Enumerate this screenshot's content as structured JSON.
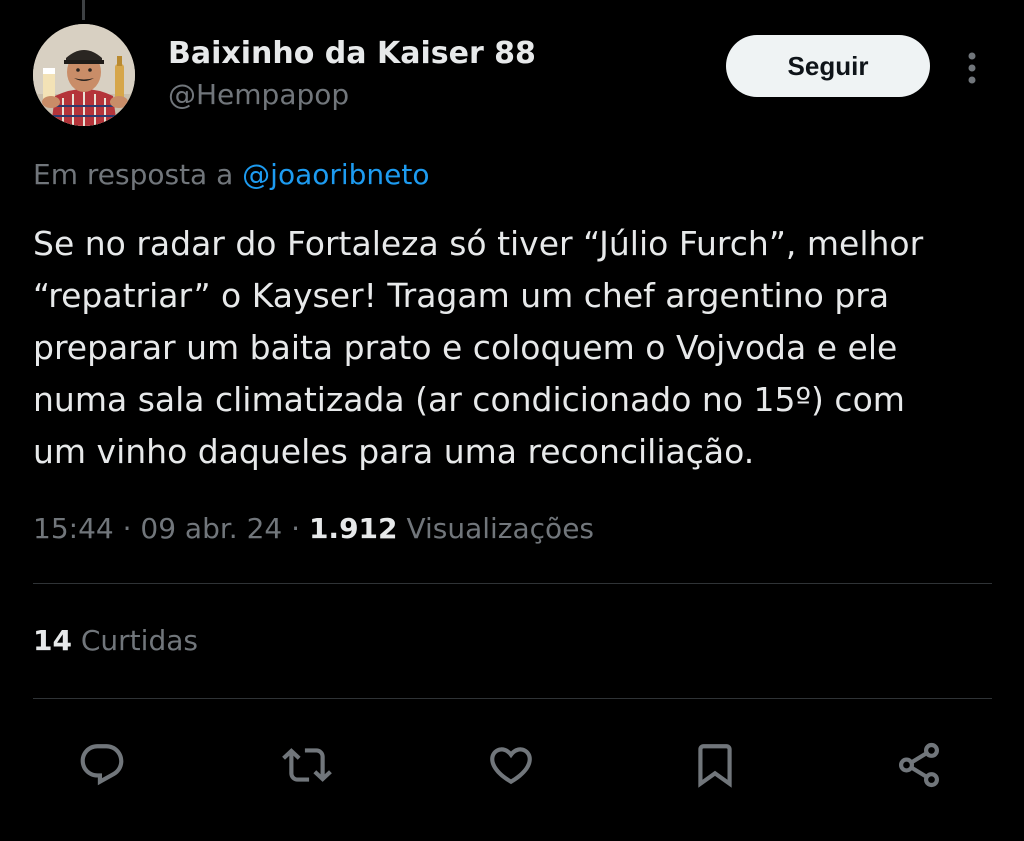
{
  "author": {
    "display_name": "Baixinho da Kaiser 88",
    "handle": "@Hempapop",
    "avatar": "avatar-photo"
  },
  "header": {
    "follow_label": "Seguir",
    "more_icon": "more-vertical-icon"
  },
  "reply_context": {
    "prefix": "Em resposta a",
    "mention": "@joaoribneto"
  },
  "tweet": {
    "lines": [
      "Se no radar do Fortaleza só tiver “Júlio Furch”, melhor",
      "“repatriar” o Kayser! Tragam um chef argentino pra",
      "preparar um baita prato e coloquem o Vojvoda e ele",
      "numa sala climatizada (ar condicionado no 15º) com",
      "um vinho daqueles para uma reconciliação."
    ]
  },
  "meta": {
    "time": "15:44",
    "separator": " · ",
    "date": "09 abr. 24",
    "views_count": "1.912",
    "views_label": "Visualizações"
  },
  "engagement": {
    "likes_count": "14",
    "likes_label": "Curtidas"
  },
  "actions": [
    {
      "name": "reply",
      "icon": "reply-icon"
    },
    {
      "name": "retweet",
      "icon": "retweet-icon"
    },
    {
      "name": "like",
      "icon": "heart-icon"
    },
    {
      "name": "bookmark",
      "icon": "bookmark-icon"
    },
    {
      "name": "share",
      "icon": "share-icon"
    }
  ],
  "colors": {
    "background": "#000000",
    "text_primary": "#e7e9ea",
    "text_secondary": "#71767b",
    "link": "#1d9bf0",
    "divider": "#2f3336",
    "button_bg": "#eff3f4",
    "button_text": "#0f1419"
  }
}
